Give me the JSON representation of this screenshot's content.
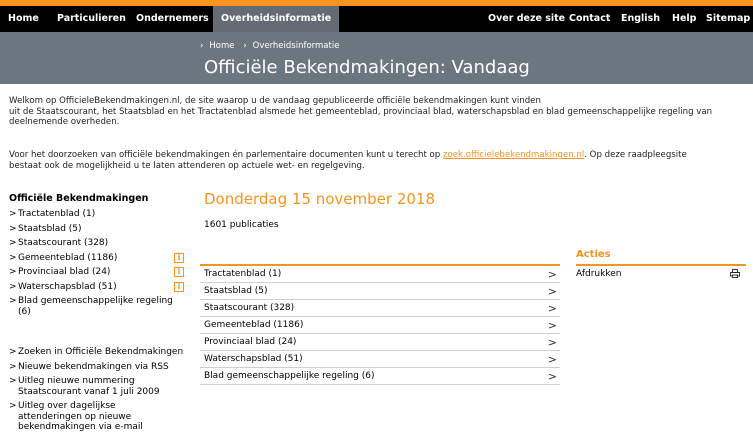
{
  "nav": {
    "items": [
      {
        "label": "Home"
      },
      {
        "label": "Particulieren"
      },
      {
        "label": "Ondernemers"
      },
      {
        "label": "Overheidsinformatie",
        "active": true
      },
      {
        "label": "Over deze site"
      },
      {
        "label": "Contact"
      },
      {
        "label": "English"
      },
      {
        "label": "Help"
      },
      {
        "label": "Sitemap"
      }
    ]
  },
  "breadcrumb": {
    "sep": "›",
    "items": [
      "Home",
      "Overheidsinformatie"
    ]
  },
  "page_title": "Officiële Bekendmakingen: Vandaag",
  "intro": {
    "p1_l1": "Welkom op OfficieleBekendmakingen.nl, de site waarop u de vandaag gepubliceerde officiële bekendmakingen kunt vinden",
    "p1_l2": "uit de Staatscourant, het Staatsblad en het Tractatenblad alsmede het gemeenteblad, provinciaal blad, waterschapsblad en blad gemeenschappelijke regeling van",
    "p1_l3": "deelnemende overheden.",
    "p2_l1_before": "Voor het doorzoeken van officiële bekendmakingen én parlementaire documenten kunt u terecht op ",
    "p2_link": "zoek.officielebekendmakingen.nl",
    "p2_l1_after": ". Op deze raadpleegsite",
    "p2_l2": "bestaat ook de mogelijkheid u te laten attenderen op actuele wet- en regelgeving."
  },
  "sidebar": {
    "title": "Officiële Bekendmakingen",
    "chevron": ">",
    "info_glyph": "i",
    "publications": [
      {
        "label": "Tractatenblad (1)"
      },
      {
        "label": "Staatsblad (5)"
      },
      {
        "label": "Staatscourant (328)"
      },
      {
        "label": "Gemeenteblad (1186)",
        "info": true
      },
      {
        "label": "Provinciaal blad (24)",
        "info": true
      },
      {
        "label": "Waterschapsblad (51)",
        "info": true
      },
      {
        "label": "Blad gemeenschappelijke regeling (6)"
      }
    ],
    "links": [
      {
        "label": "Zoeken in Officiële Bekendmakingen"
      },
      {
        "label": "Nieuwe bekendmakingen via RSS"
      },
      {
        "label": "Uitleg nieuwe nummering Staatscourant vanaf 1 juli 2009"
      },
      {
        "label": "Uitleg over dagelijkse attenderingen op nieuwe bekendmakingen via e-mail"
      }
    ]
  },
  "main": {
    "date": "Donderdag 15 november 2018",
    "count": "1601 publicaties",
    "chevron": ">",
    "publications": [
      "Tractatenblad (1)",
      "Staatsblad (5)",
      "Staatscourant (328)",
      "Gemeenteblad (1186)",
      "Provinciaal blad (24)",
      "Waterschapsblad (51)",
      "Blad gemeenschappelijke regeling (6)"
    ]
  },
  "acties": {
    "title": "Acties",
    "print_label": "Afdrukken",
    "print_icon": "printer-icon"
  },
  "colors": {
    "accent": "#f7931e",
    "nav_bg": "#000000",
    "nav_active": "#646b75",
    "banner_bg": "#6c7680"
  }
}
